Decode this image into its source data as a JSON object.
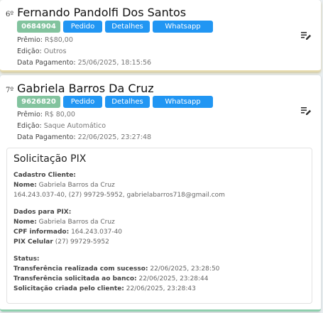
{
  "cards": [
    {
      "rank": "6º",
      "name": "Fernando Pandolfi Dos Santos",
      "code": "0684904",
      "buttons": {
        "pedido": "Pedido",
        "detalhes": "Detalhes",
        "whatsapp": "Whatsapp"
      },
      "premio_label": "Prêmio:",
      "premio_value": "R$80,00",
      "edicao_label": "Edição:",
      "edicao_value": "Outros",
      "pagamento_label": "Data Pagamento:",
      "pagamento_value": "25/06/2025, 18:15:56",
      "edit_icon": "edit-list-icon"
    },
    {
      "rank": "7º",
      "name": "Gabriela Barros Da Cruz",
      "code": "9626820",
      "buttons": {
        "pedido": "Pedido",
        "detalhes": "Detalhes",
        "whatsapp": "Whatsapp"
      },
      "premio_label": "Prêmio:",
      "premio_value": "R$ 80,00",
      "edicao_label": "Edição:",
      "edicao_value": "Saque Automático",
      "pagamento_label": "Data Pagamento:",
      "pagamento_value": "22/06/2025, 23:27:48",
      "edit_icon": "edit-list-icon",
      "pix": {
        "title": "Solicitação PIX",
        "cadastro_heading": "Cadastro Cliente:",
        "cadastro_nome_label": "Nome:",
        "cadastro_nome_value": "Gabriela Barros da Cruz",
        "cadastro_contact": "164.243.037-40, (27) 99729-5952, gabrielabarros718@gmail.com",
        "dados_heading": "Dados para PIX:",
        "dados_nome_label": "Nome:",
        "dados_nome_value": "Gabriela Barros da Cruz",
        "cpf_label": "CPF informado:",
        "cpf_value": "164.243.037-40",
        "pix_label": "PIX Celular",
        "pix_value": "(27) 99729-5952",
        "status_heading": "Status:",
        "status_1_label": "Transferência realizada com sucesso:",
        "status_1_value": "22/06/2025, 23:28:50",
        "status_2_label": "Transferência solicitada ao banco:",
        "status_2_value": "22/06/2025, 23:28:44",
        "status_3_label": "Solicitação criada pelo cliente:",
        "status_3_value": "22/06/2025, 23:28:43"
      }
    }
  ],
  "colors": {
    "code_badge": "#82c39e",
    "button_blue": "#2196f3",
    "card2_accent": "#8fcfae",
    "card1_accent": "#e7dcae"
  }
}
